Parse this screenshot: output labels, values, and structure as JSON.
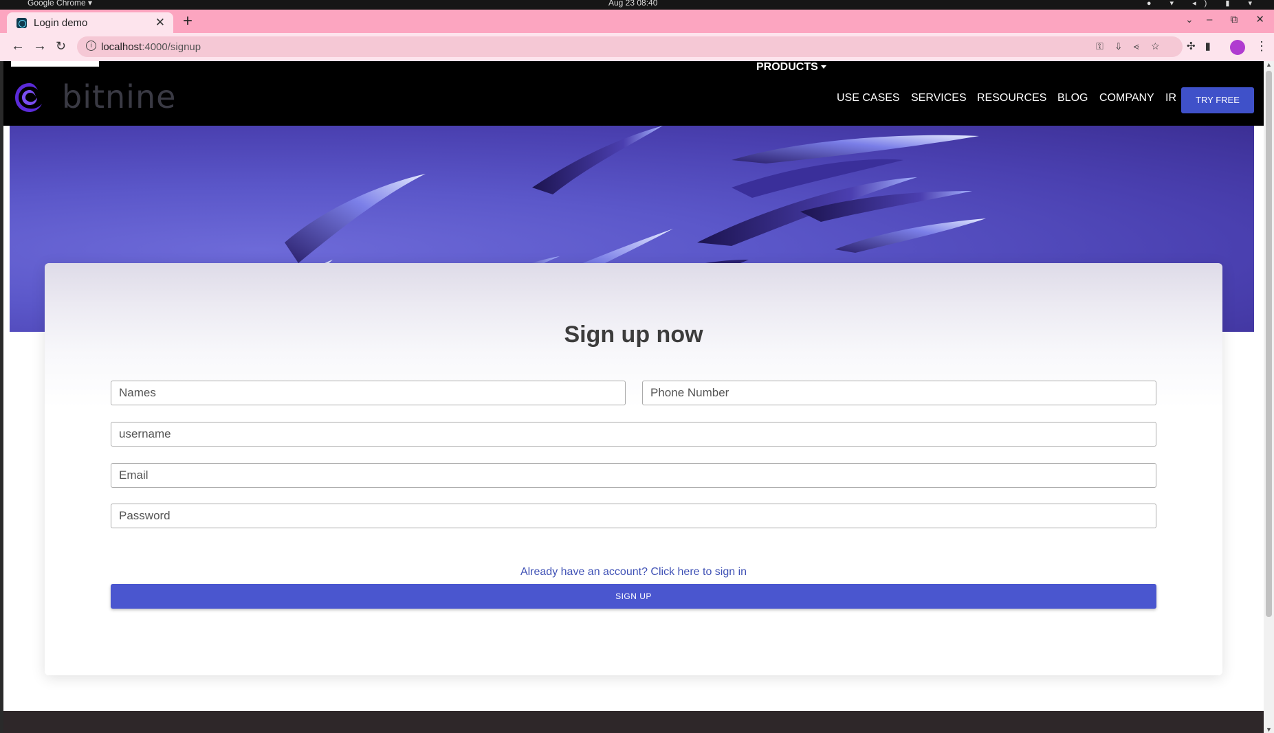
{
  "os": {
    "app_label": "Google Chrome ▾",
    "clock": "Aug 23  08:40"
  },
  "browser": {
    "tab_title": "Login demo",
    "url_host": "localhost",
    "url_path": ":4000/signup"
  },
  "site": {
    "logo_text": "bitnine",
    "nav": {
      "products": "PRODUCTS",
      "use_cases": "USE CASES",
      "services": "SERVICES",
      "resources": "RESOURCES",
      "blog": "BLOG",
      "company": "COMPANY",
      "ir": "IR",
      "try_free": "TRY FREE"
    }
  },
  "form": {
    "title": "Sign up now",
    "names_placeholder": "Names",
    "phone_placeholder": "Phone Number",
    "username_placeholder": "username",
    "email_placeholder": "Email",
    "password_placeholder": "Password",
    "signin_link": "Already have an account? Click here to sign in",
    "signup_button": "SIGN UP"
  },
  "colors": {
    "accent": "#4a56cf",
    "tab_strip": "#fca5c0",
    "navbar": "#000000",
    "link": "#3f51b5"
  }
}
